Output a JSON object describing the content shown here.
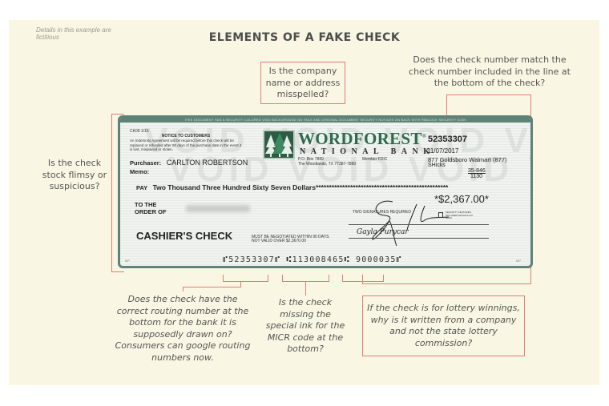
{
  "note": "Details in this example are fictitious",
  "title": "ELEMENTS OF A FAKE CHECK",
  "callouts": {
    "company_name": "Is the company name or address misspelled?",
    "check_number": "Does the check number match the check number included in the line at the bottom of the check?",
    "check_stock": "Is the check stock flimsy or suspicious?",
    "routing_number": "Does the check have the correct routing number at the bottom for the bank it is supposedly drawn on? Consumers can google routing numbers now.",
    "micr_ink": "Is the check missing the special ink for the MICR code at the bottom?",
    "lottery": "If the check is for lottery winnings, why is it written from a company and not the state lottery commission?"
  },
  "check": {
    "security_band": "THIS DOCUMENT HAS A SECURITY COLORED VOID BACKGROUND ON FACE AND ORIGINAL DOCUMENT SECURITY NOTICES ON BACK WITH PADLOCK SECURITY ICON",
    "void_text": "VOID VOID VOID VOID",
    "form_code": "CK09  1/15",
    "notice_title": "NOTICE TO CUSTOMERS",
    "notice_body": "An Indemnity Agreement will be required before this check will be replaced or refunded after 90 days of the purchase date in the event it is lost, misplaced or stolen.",
    "purchaser_label": "Purchaser:",
    "purchaser_name": "CARLTON ROBERTSON",
    "memo_label": "Memo:",
    "bank_name": "WORDFOREST",
    "bank_registered": "®",
    "bank_subtitle": "NATIONAL BANK",
    "bank_address_1": "P.O. Box 7889",
    "bank_address_2": "The Woodlands, TX 77387-7889",
    "member_fdic": "Member FDIC",
    "check_number": "52353307",
    "date": "11/07/2017",
    "branch": "877 Goldsboro Walmart (877)",
    "clerk": "SHicks",
    "fraction_top": "35-846",
    "fraction_bottom": "1130",
    "pay_label": "PAY",
    "amount_words": "Two Thousand Three Hundred Sixty Seven Dollars**************************************************",
    "amount": "*$2,367.00*",
    "order_label_1": "TO THE",
    "order_label_2": "ORDER OF",
    "signatures_required": "TWO SIGNATURES REQUIRED",
    "padlock_text": "SECURITY FEATURES INCLUDED DETAILS ON BACK",
    "check_type": "CASHIER'S CHECK",
    "negotiate_1": "MUST BE NEGOTIATED WITHIN 90 DAYS",
    "negotiate_2": "NOT VALID OVER $2,3670.00",
    "signature_name": "Gayla Purycar",
    "micr_line": "⑈52353307⑈ ⑆113008465⑆ 9000035⑈",
    "corner_mark": "MP"
  }
}
